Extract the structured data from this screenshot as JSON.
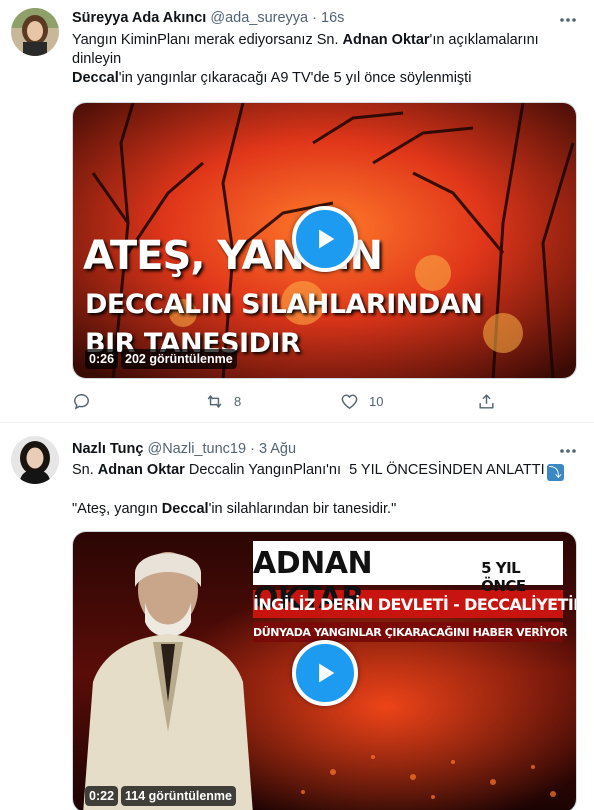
{
  "tweet1": {
    "author_name": "Süreyya Ada Akıncı",
    "author_handle": "@ada_sureyya",
    "separator": "·",
    "time": "16s",
    "text_line1_a": "Yangın KiminPlanı merak ediyorsanız Sn. ",
    "text_line1_b": "Adnan Oktar",
    "text_line1_c": "'ın açıklamalarını",
    "text_line2": "dinleyin",
    "text_line3_a": "Deccal",
    "text_line3_b": "'in yangınlar çıkaracağı A9 TV'de 5 yıl önce söylenmişti",
    "video": {
      "caption_line1": "ATEŞ, YANGIN",
      "caption_line2": "DECCALIN SILAHLARINDAN",
      "caption_line3": "BIR TANESIDIR",
      "duration": "0:26",
      "views": "202 görüntülenme"
    },
    "retweets": "8",
    "likes": "10"
  },
  "tweet2": {
    "author_name": "Nazlı Tunç",
    "author_handle": "@Nazli_tunc19",
    "separator": "·",
    "time": "3 Ağu",
    "text_line1_a": "Sn. ",
    "text_line1_b": "Adnan Oktar",
    "text_line1_c": " Deccalin YangınPlanı'nı  5 YIL ÖNCESİNDEN ANLATTI",
    "text_line2_a": "\"Ateş, yangın ",
    "text_line2_b": "Deccal",
    "text_line2_c": "'in silahlarından bir tanesidir.\"",
    "video": {
      "banner_title": "ADNAN OKTAR",
      "banner_sub": "5 YIL ÖNCE",
      "banner_line2": "İNGİLİZ DERİN DEVLETİ - DECCALİYETİN",
      "banner_line3": "DÜNYADA YANGINLAR ÇIKARACAĞINI HABER VERİYOR",
      "duration": "0:22",
      "views": "114 görüntülenme"
    }
  },
  "colors": {
    "accent": "#1d9bf0",
    "secondary_text": "#536471",
    "fire_orange": "#ff5a1a",
    "fire_dark": "#3a0a05"
  },
  "icons": [
    "more-icon",
    "play-icon",
    "reply-icon",
    "retweet-icon",
    "like-icon",
    "share-icon",
    "arrow-down-right-emoji-icon"
  ]
}
